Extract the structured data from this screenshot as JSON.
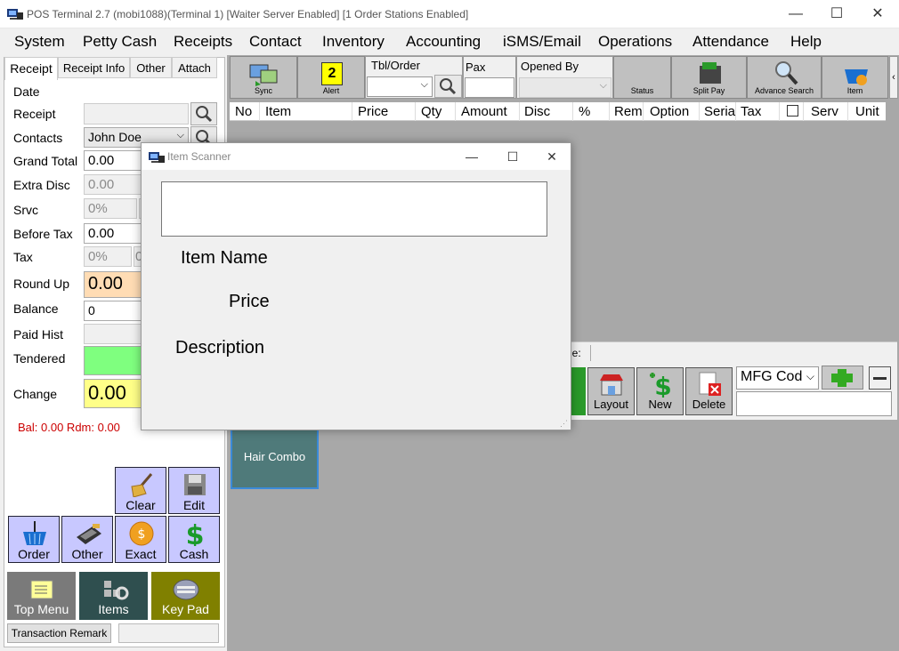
{
  "window": {
    "title": "POS Terminal 2.7 (mobi1088)(Terminal 1) [Waiter Server Enabled] [1 Order Stations Enabled]",
    "controls": {
      "minimize": "—",
      "maximize": "☐",
      "close": "✕"
    }
  },
  "menu": [
    "System",
    "Petty Cash",
    "Receipts",
    "Contact",
    "Inventory",
    "Accounting",
    "iSMS/Email",
    "Operations",
    "Attendance",
    "Help"
  ],
  "left_tabs": [
    "Receipt",
    "Receipt Info",
    "Other",
    "Attach"
  ],
  "receipt_fields": {
    "date_label": "Date",
    "receipt_label": "Receipt",
    "contacts_label": "Contacts",
    "contacts_value": "John Doe",
    "grand_total_label": "Grand Total",
    "grand_total_value": "0.00",
    "extra_disc_label": "Extra Disc",
    "extra_disc_value": "0.00",
    "srvc_label": "Srvc",
    "srvc_value": "0%",
    "before_tax_label": "Before Tax",
    "before_tax_value": "0.00",
    "tax_label": "Tax",
    "tax_value": "0%",
    "tax_value2": "0",
    "round_up_label": "Round Up",
    "round_up_value": "0.00",
    "balance_label": "Balance",
    "balance_value": "0",
    "paid_hist_label": "Paid Hist",
    "tendered_label": "Tendered",
    "change_label": "Change",
    "change_value": "0.00",
    "bal_rdm": "Bal: 0.00 Rdm: 0.00"
  },
  "action_buttons": {
    "clear": "Clear",
    "edit": "Edit",
    "order": "Order",
    "other": "Other",
    "exact": "Exact",
    "cash": "Cash"
  },
  "nav_buttons": {
    "top_menu": "Top Menu",
    "items": "Items",
    "key_pad": "Key Pad"
  },
  "transaction_remark": "Transaction Remark",
  "toolbar": {
    "sync": "Sync",
    "alert": "Alert",
    "alert_count": "2",
    "tbl_order": "Tbl/Order",
    "pax": "Pax",
    "opened_by": "Opened By",
    "status": "Status",
    "split_pay": "Split Pay",
    "advance_search": "Advance Search",
    "item": "Item"
  },
  "grid_columns": [
    "No",
    "Item",
    "Price",
    "Qty",
    "Amount",
    "Disc",
    "%",
    "Rem",
    "Option",
    "Seria",
    "Tax",
    "Serv",
    "Unit"
  ],
  "lower_toolbar": {
    "layout": "Layout",
    "new": "New",
    "delete": "Delete",
    "mfg_code": "MFG Cod",
    "partial_label": "le:"
  },
  "item_tiles": [
    "Hair Combo"
  ],
  "dialog": {
    "title": "Item Scanner",
    "item_name_label": "Item Name",
    "price_label": "Price",
    "description_label": "Description"
  },
  "colors": {
    "round_up_bg": "#ffdcb4",
    "tendered_bg": "#7fff7f",
    "change_bg": "#ffff88",
    "action_btn_bg": "#c8c8ff",
    "top_menu_bg": "#7a7a7a",
    "items_bg": "#2f4f4f",
    "key_pad_bg": "#808000",
    "tile_bg": "#4f7a7a",
    "bal_text": "#cc0000"
  }
}
